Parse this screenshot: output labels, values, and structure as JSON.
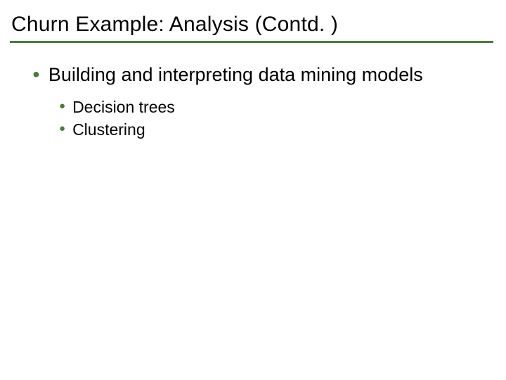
{
  "title": "Churn Example: Analysis (Contd. )",
  "bullets": {
    "main": "Building and interpreting data mining models",
    "subs": [
      "Decision trees",
      "Clustering"
    ]
  },
  "colors": {
    "accent": "#4a7a3a"
  }
}
